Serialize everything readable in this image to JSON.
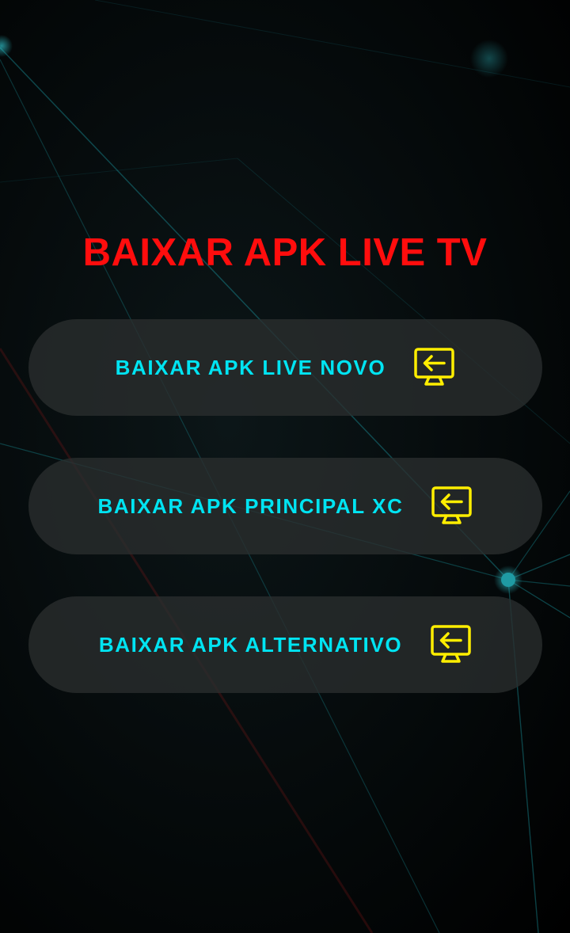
{
  "page": {
    "title": "BAIXAR APK LIVE TV"
  },
  "buttons": [
    {
      "label": "BAIXAR APK LIVE NOVO",
      "icon": "monitor-arrow-left-icon"
    },
    {
      "label": "BAIXAR APK PRINCIPAL XC",
      "icon": "monitor-arrow-left-icon"
    },
    {
      "label": "BAIXAR APK ALTERNATIVO",
      "icon": "monitor-arrow-left-icon"
    }
  ],
  "colors": {
    "title": "#ff0d0d",
    "button_text": "#00e4f2",
    "icon": "#ffee00",
    "button_bg": "#2a2e2e",
    "network_lines": "#1fb8c4"
  }
}
